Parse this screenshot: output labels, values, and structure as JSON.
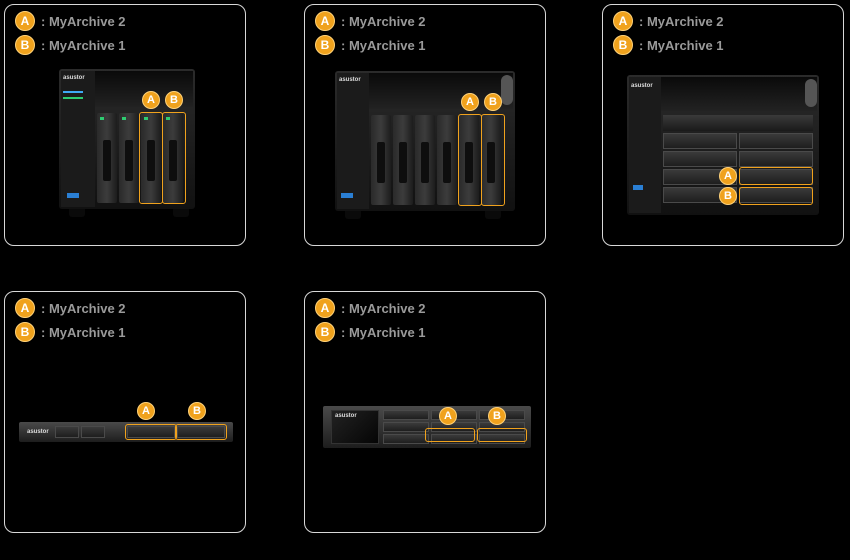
{
  "legend": {
    "a_letter": "A",
    "b_letter": "B",
    "a_label": ": MyArchive 2",
    "b_label": ": MyArchive 1"
  },
  "brand": "asustor",
  "colors": {
    "accent": "#f0a21d",
    "border": "#d8d8d8",
    "background": "#000000"
  }
}
